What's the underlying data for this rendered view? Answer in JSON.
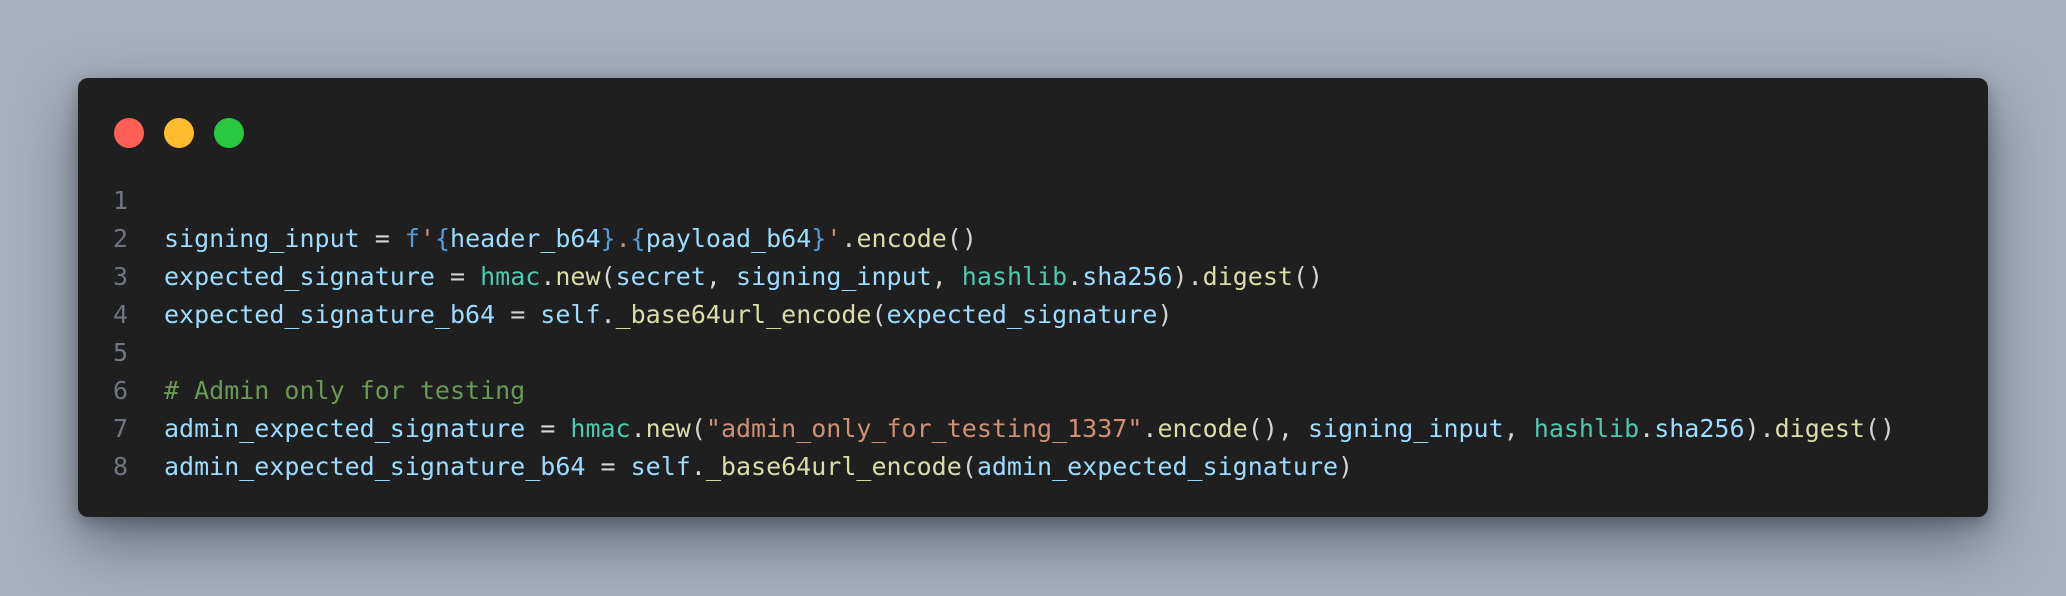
{
  "window": {
    "controls": [
      {
        "name": "close",
        "color": "#ff5f56"
      },
      {
        "name": "minimize",
        "color": "#ffbd2e"
      },
      {
        "name": "maximize",
        "color": "#27c93f"
      }
    ]
  },
  "code": {
    "language": "python",
    "lines": [
      {
        "number": "1",
        "tokens": []
      },
      {
        "number": "2",
        "tokens": [
          {
            "t": "signing_input",
            "c": "var"
          },
          {
            "t": " = ",
            "c": "op"
          },
          {
            "t": "f",
            "c": "pfx"
          },
          {
            "t": "'",
            "c": "str"
          },
          {
            "t": "{",
            "c": "brace"
          },
          {
            "t": "header_b64",
            "c": "var"
          },
          {
            "t": "}",
            "c": "brace"
          },
          {
            "t": ".",
            "c": "str"
          },
          {
            "t": "{",
            "c": "brace"
          },
          {
            "t": "payload_b64",
            "c": "var"
          },
          {
            "t": "}",
            "c": "brace"
          },
          {
            "t": "'",
            "c": "str"
          },
          {
            "t": ".",
            "c": "op"
          },
          {
            "t": "encode",
            "c": "fn"
          },
          {
            "t": "()",
            "c": "op"
          }
        ]
      },
      {
        "number": "3",
        "tokens": [
          {
            "t": "expected_signature",
            "c": "var"
          },
          {
            "t": " = ",
            "c": "op"
          },
          {
            "t": "hmac",
            "c": "mod"
          },
          {
            "t": ".",
            "c": "op"
          },
          {
            "t": "new",
            "c": "fn"
          },
          {
            "t": "(",
            "c": "op"
          },
          {
            "t": "secret",
            "c": "var"
          },
          {
            "t": ", ",
            "c": "op"
          },
          {
            "t": "signing_input",
            "c": "var"
          },
          {
            "t": ", ",
            "c": "op"
          },
          {
            "t": "hashlib",
            "c": "mod"
          },
          {
            "t": ".",
            "c": "op"
          },
          {
            "t": "sha256",
            "c": "var"
          },
          {
            "t": ").",
            "c": "op"
          },
          {
            "t": "digest",
            "c": "fn"
          },
          {
            "t": "()",
            "c": "op"
          }
        ]
      },
      {
        "number": "4",
        "tokens": [
          {
            "t": "expected_signature_b64",
            "c": "var"
          },
          {
            "t": " = ",
            "c": "op"
          },
          {
            "t": "self",
            "c": "var"
          },
          {
            "t": ".",
            "c": "op"
          },
          {
            "t": "_base64url_encode",
            "c": "fn"
          },
          {
            "t": "(",
            "c": "op"
          },
          {
            "t": "expected_signature",
            "c": "var"
          },
          {
            "t": ")",
            "c": "op"
          }
        ]
      },
      {
        "number": "5",
        "tokens": []
      },
      {
        "number": "6",
        "tokens": [
          {
            "t": "# Admin only for testing",
            "c": "com"
          }
        ]
      },
      {
        "number": "7",
        "tokens": [
          {
            "t": "admin_expected_signature",
            "c": "var"
          },
          {
            "t": " = ",
            "c": "op"
          },
          {
            "t": "hmac",
            "c": "mod"
          },
          {
            "t": ".",
            "c": "op"
          },
          {
            "t": "new",
            "c": "fn"
          },
          {
            "t": "(",
            "c": "op"
          },
          {
            "t": "\"admin_only_for_testing_1337\"",
            "c": "str"
          },
          {
            "t": ".",
            "c": "op"
          },
          {
            "t": "encode",
            "c": "fn"
          },
          {
            "t": "(), ",
            "c": "op"
          },
          {
            "t": "signing_input",
            "c": "var"
          },
          {
            "t": ", ",
            "c": "op"
          },
          {
            "t": "hashlib",
            "c": "mod"
          },
          {
            "t": ".",
            "c": "op"
          },
          {
            "t": "sha256",
            "c": "var"
          },
          {
            "t": ").",
            "c": "op"
          },
          {
            "t": "digest",
            "c": "fn"
          },
          {
            "t": "()",
            "c": "op"
          }
        ]
      },
      {
        "number": "8",
        "tokens": [
          {
            "t": "admin_expected_signature_b64",
            "c": "var"
          },
          {
            "t": " = ",
            "c": "op"
          },
          {
            "t": "self",
            "c": "var"
          },
          {
            "t": ".",
            "c": "op"
          },
          {
            "t": "_base64url_encode",
            "c": "fn"
          },
          {
            "t": "(",
            "c": "op"
          },
          {
            "t": "admin_expected_signature",
            "c": "var"
          },
          {
            "t": ")",
            "c": "op"
          }
        ]
      }
    ]
  }
}
